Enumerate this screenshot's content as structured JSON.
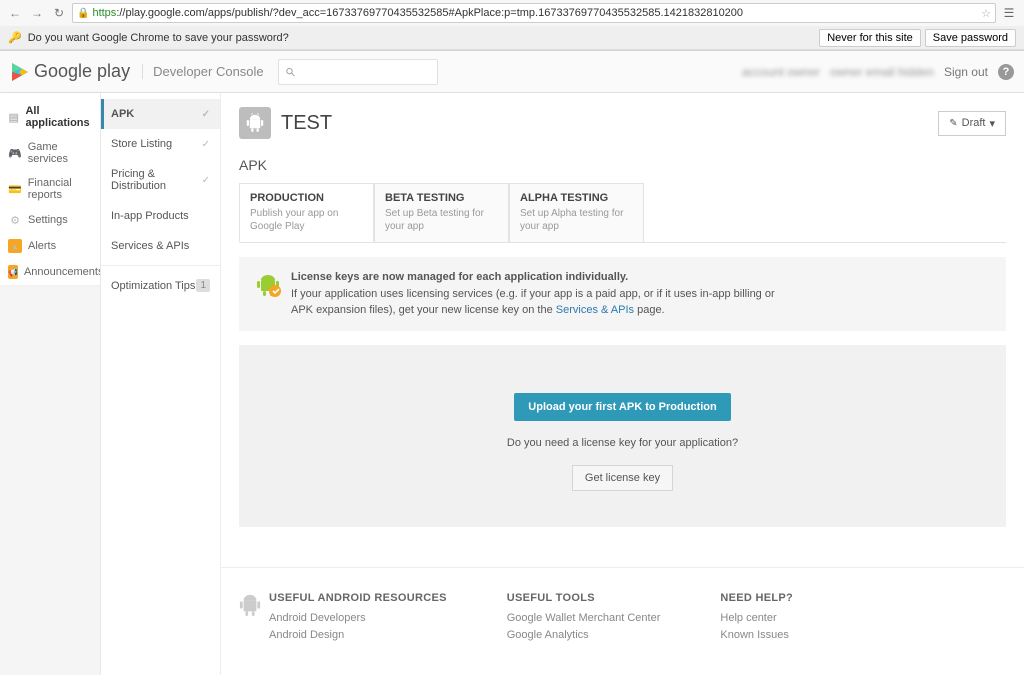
{
  "browser": {
    "url_scheme": "https",
    "url_rest": "://play.google.com/apps/publish/?dev_acc=16733769770435532585#ApkPlace:p=tmp.16733769770435532585.1421832810200",
    "save_pw_prompt": "Do you want Google Chrome to save your password?",
    "never_button": "Never for this site",
    "save_pw_button": "Save password"
  },
  "header": {
    "brand": "Google play",
    "section": "Developer Console",
    "search_placeholder": "",
    "user_name_blur": "account owner",
    "user_email_blur": "owner email hidden",
    "signout": "Sign out"
  },
  "leftnav": {
    "all_apps": "All applications",
    "game_services": "Game services",
    "financial_reports": "Financial reports",
    "settings": "Settings",
    "alerts": "Alerts",
    "announcements": "Announcements"
  },
  "subnav": {
    "apk": "APK",
    "store_listing": "Store Listing",
    "pricing": "Pricing & Distribution",
    "inapp": "In-app Products",
    "services": "Services & APIs",
    "optimization": "Optimization Tips",
    "optimization_count": "1"
  },
  "page": {
    "app_name": "TEST",
    "draft_label": "Draft",
    "section_heading": "APK"
  },
  "tabs": {
    "production": {
      "title": "PRODUCTION",
      "desc": "Publish your app on Google Play"
    },
    "beta": {
      "title": "BETA TESTING",
      "desc": "Set up Beta testing for your app"
    },
    "alpha": {
      "title": "ALPHA TESTING",
      "desc": "Set up Alpha testing for your app"
    }
  },
  "notice": {
    "bold": "License keys are now managed for each application individually.",
    "line1": "If your application uses licensing services (e.g. if your app is a paid app, or if it uses in-app billing or",
    "line2a": "APK expansion files), get your new license key on the ",
    "link": "Services & APIs",
    "line2b": " page."
  },
  "upload": {
    "button": "Upload your first APK to Production",
    "question": "Do you need a license key for your application?",
    "get_key": "Get license key"
  },
  "footer": {
    "col1_h": "USEFUL ANDROID RESOURCES",
    "col1_a": "Android Developers",
    "col1_b": "Android Design",
    "col2_h": "USEFUL TOOLS",
    "col2_a": "Google Wallet Merchant Center",
    "col2_b": "Google Analytics",
    "col3_h": "NEED HELP?",
    "col3_a": "Help center",
    "col3_b": "Known Issues"
  }
}
